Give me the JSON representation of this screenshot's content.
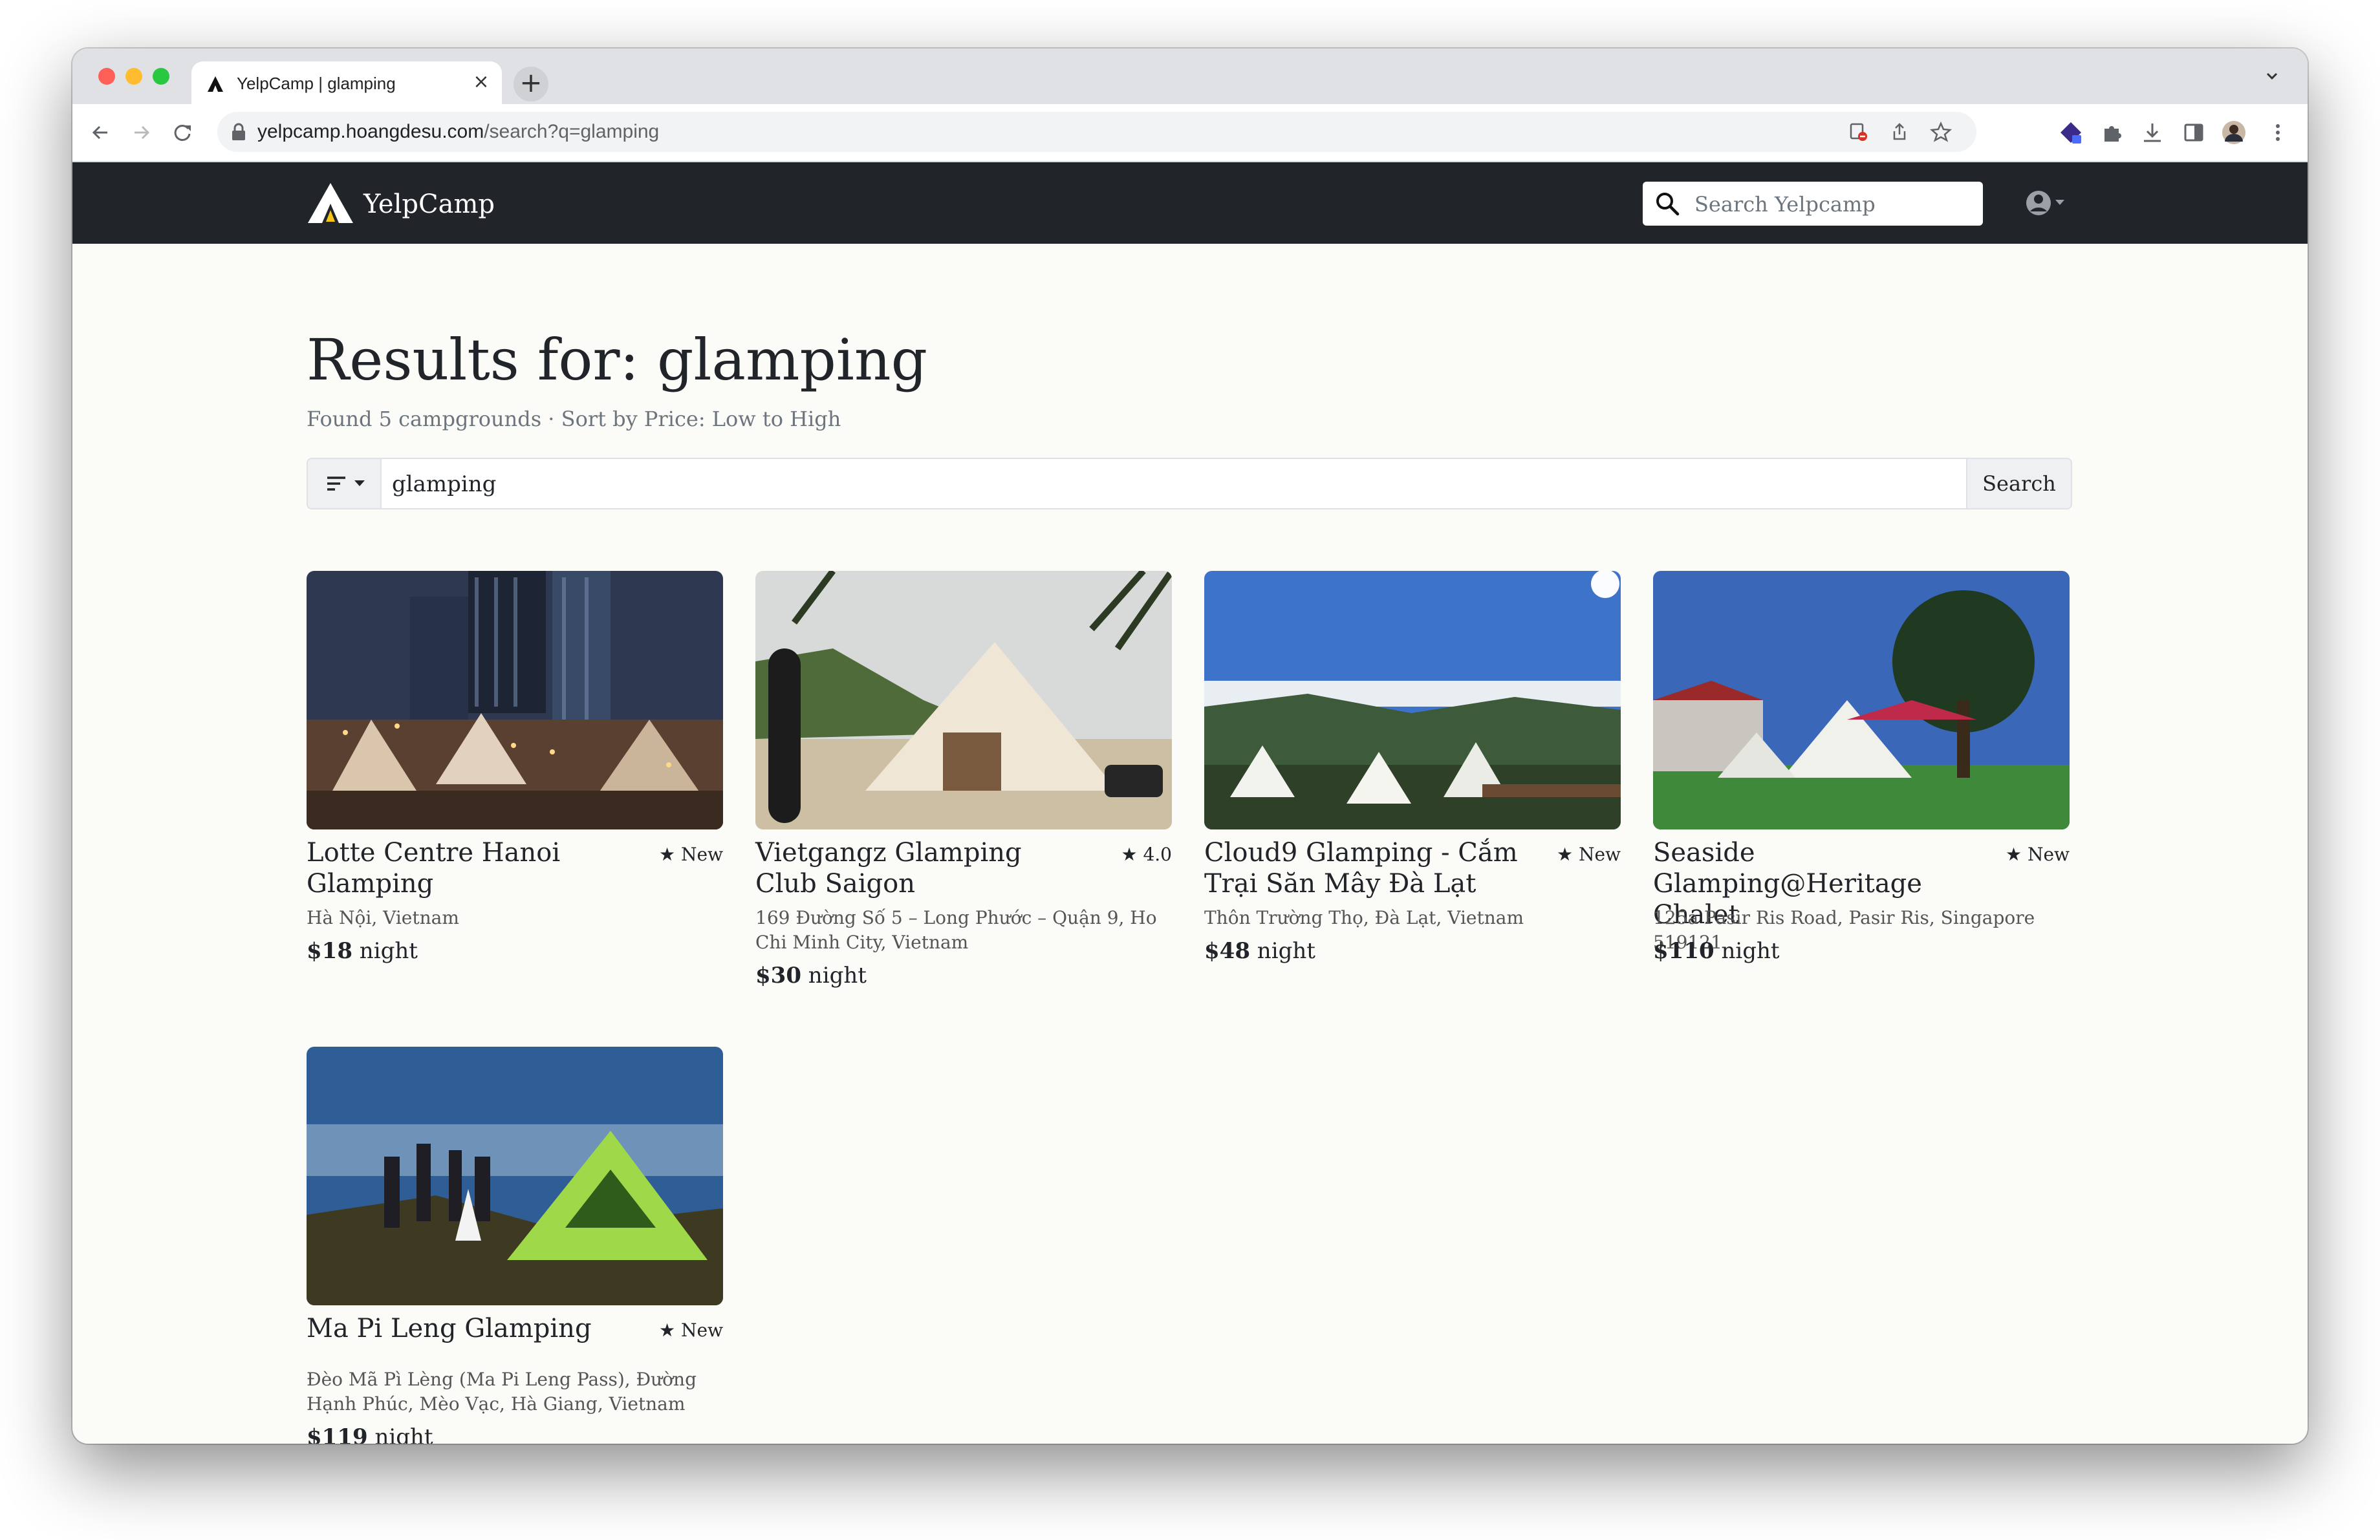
{
  "browser": {
    "tab_title": "YelpCamp | glamping",
    "new_tab_label": "+",
    "close_label": "×",
    "url_host": "yelpcamp.hoangdesu.com",
    "url_path": "/search?q=glamping"
  },
  "navbar": {
    "brand": "YelpCamp",
    "search_placeholder": "Search Yelpcamp",
    "icons": [
      "yelpcamp-logo-icon",
      "search-icon",
      "user-circle-icon",
      "caret-down-icon"
    ]
  },
  "page": {
    "title": "Results for: glamping",
    "summary": "Found 5 campgrounds · Sort by Price: Low to High",
    "search_value": "glamping",
    "search_button": "Search"
  },
  "campgrounds": [
    {
      "title": "Lotte Centre Hanoi Glamping",
      "rating": "★ New",
      "location": "Hà Nội, Vietnam",
      "price": "$18",
      "unit": "night",
      "image": "city-rooftop-bell-tents"
    },
    {
      "title": "Vietgangz Glamping Club Saigon",
      "rating": "★ 4.0",
      "location": "169 Đường Số 5 – Long Phước – Quận 9, Ho Chi Minh City, Vietnam",
      "price": "$30",
      "unit": "night",
      "image": "beach-bell-tent"
    },
    {
      "title": "Cloud9 Glamping - Cắm Trại Săn Mây Đà Lạt",
      "rating": "★ New",
      "location": "Thôn Trường Thọ, Đà Lạt, Vietnam",
      "price": "$48",
      "unit": "night",
      "image": "mountain-cloud-view"
    },
    {
      "title": "Seaside Glamping@Heritage Chalet",
      "rating": "★ New",
      "location": "125a Pasir Ris Road, Pasir Ris, Singapore 519121",
      "price": "$110",
      "unit": "night",
      "image": "lawn-bell-tents-dusk"
    },
    {
      "title": "Ma Pi Leng Glamping",
      "rating": "★ New",
      "location": "Đèo Mã Pì Lèng (Ma Pi Leng Pass), Đường Hạnh Phúc, Mèo Vạc, Hà Giang, Vietnam",
      "price": "$119",
      "unit": "night",
      "image": "hillside-green-tent"
    }
  ]
}
